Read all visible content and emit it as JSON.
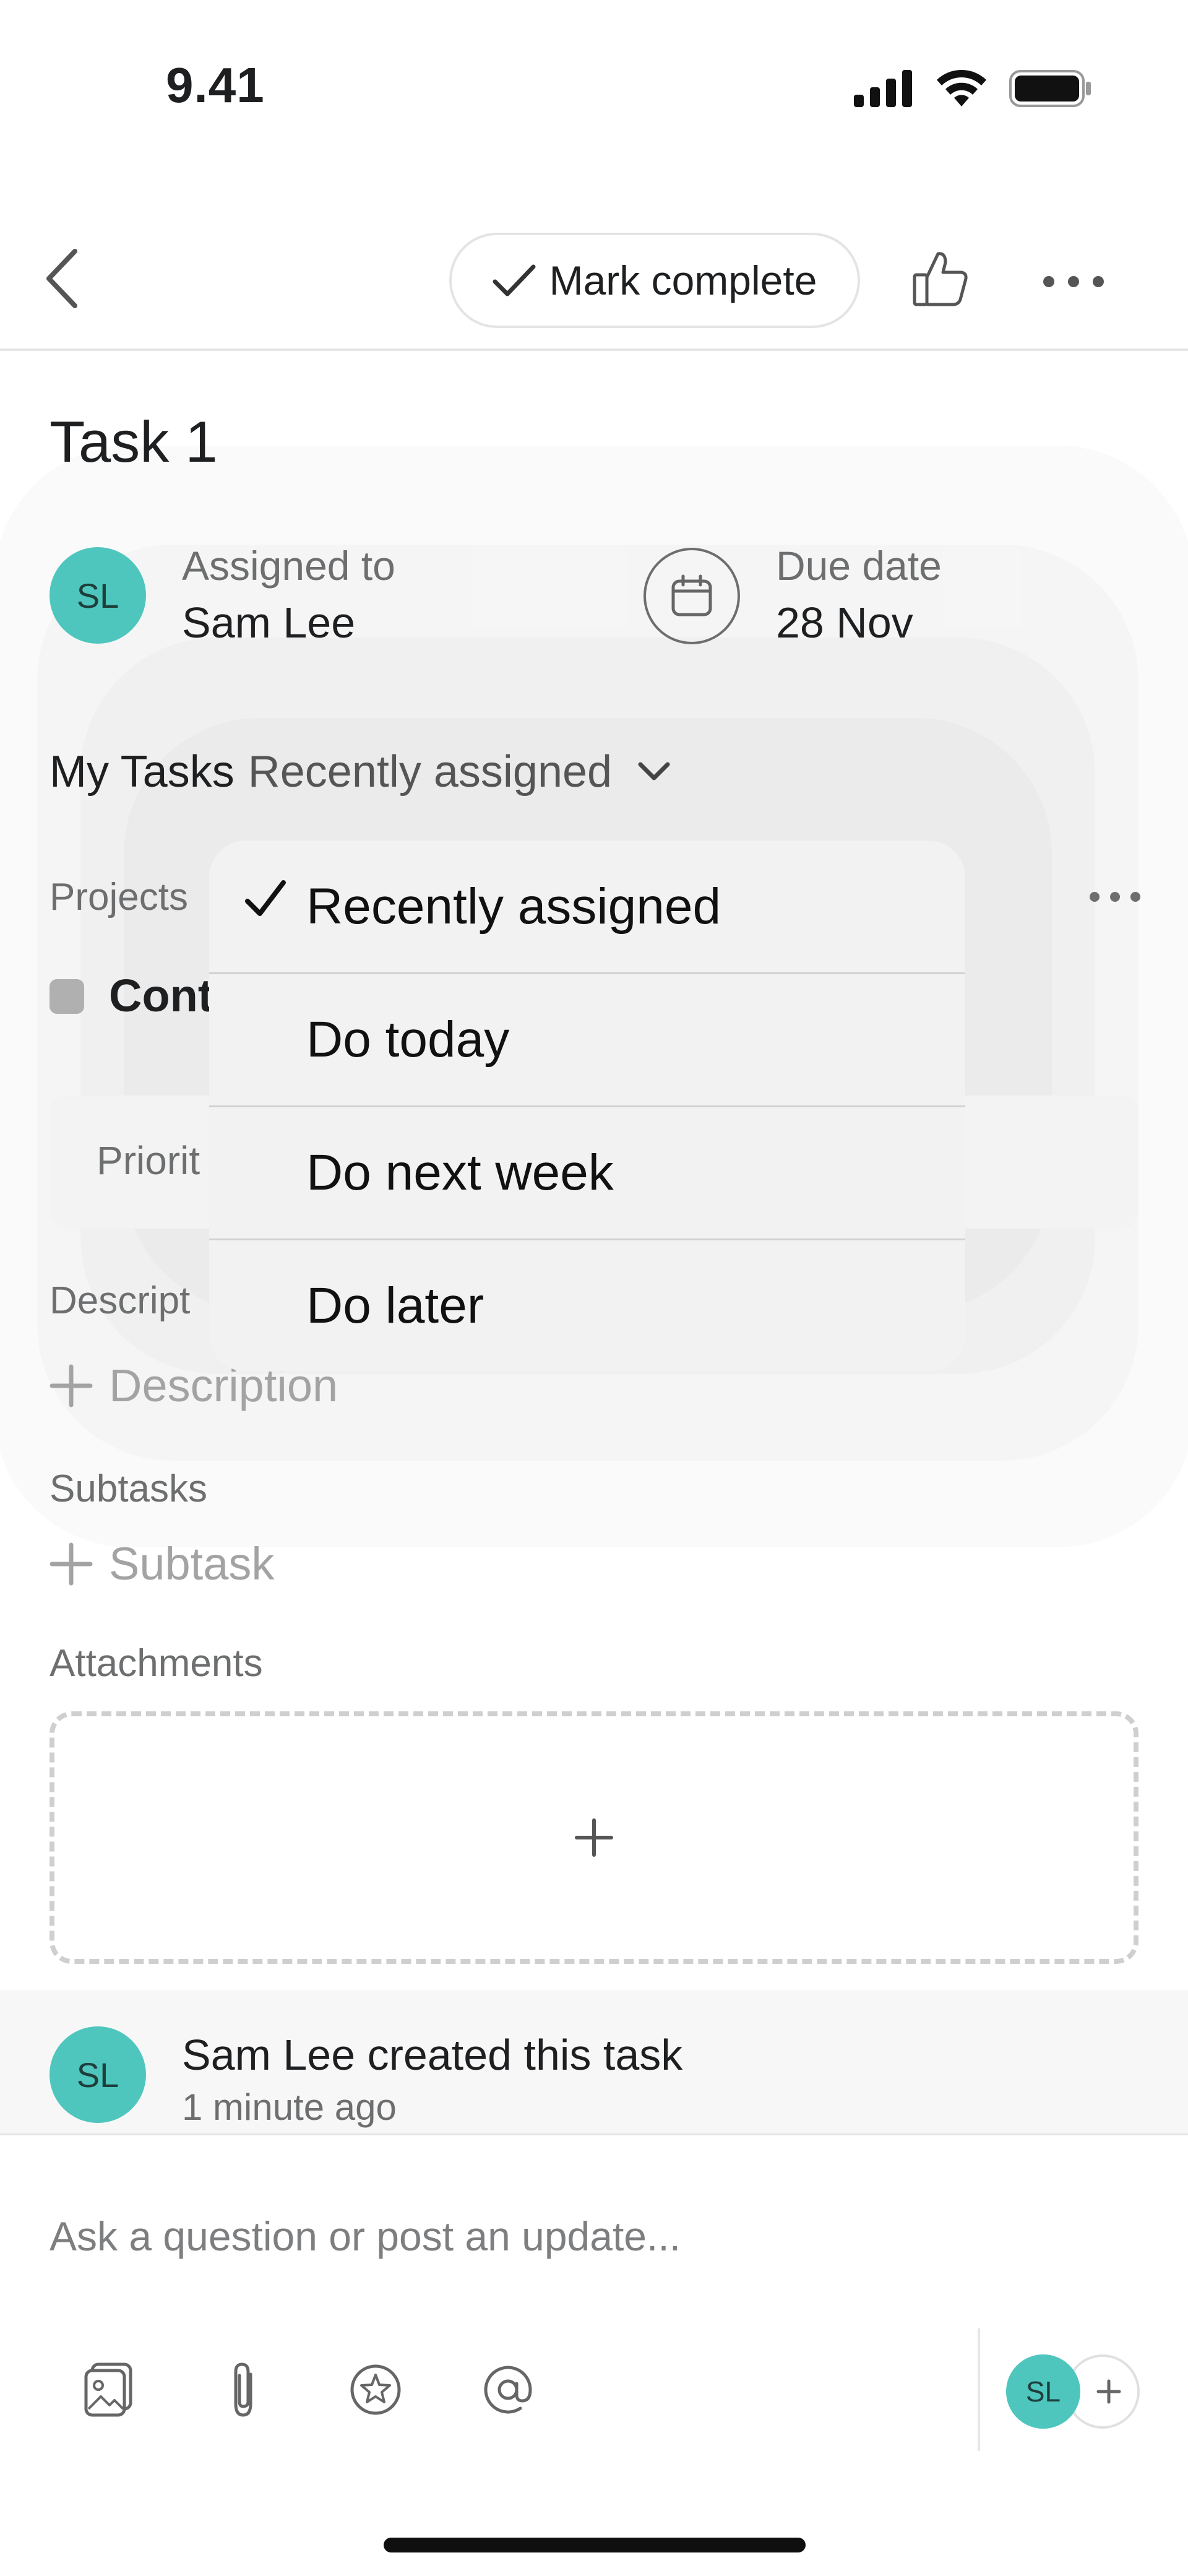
{
  "status_bar": {
    "time": "9.41"
  },
  "nav": {
    "mark_complete_label": "Mark complete"
  },
  "task": {
    "title": "Task 1",
    "assignee": {
      "label": "Assigned to",
      "name": "Sam Lee",
      "initials": "SL"
    },
    "due_date": {
      "label": "Due date",
      "value": "28 Nov"
    },
    "section": {
      "project": "My Tasks",
      "selected": "Recently assigned"
    }
  },
  "sections": {
    "projects_label": "Projects",
    "project_partial": "Cont",
    "priority_partial": "Priorit",
    "description_label_partial": "Descript",
    "description_add": "Description",
    "subtasks_label": "Subtasks",
    "subtask_add": "Subtask",
    "attachments_label": "Attachments"
  },
  "activity": {
    "text": "Sam Lee created this task",
    "time": "1 minute ago",
    "initials": "SL"
  },
  "composer": {
    "placeholder": "Ask a question or post an update...",
    "user_initials": "SL"
  },
  "dropdown": {
    "items": [
      {
        "label": "Recently assigned",
        "selected": true
      },
      {
        "label": "Do today",
        "selected": false
      },
      {
        "label": "Do next week",
        "selected": false
      },
      {
        "label": "Do later",
        "selected": false
      }
    ]
  },
  "colors": {
    "avatar": "#4ec6bd",
    "text": "#1e1f21",
    "muted": "#6d6e6f"
  },
  "icons": [
    "signal-icon",
    "wifi-icon",
    "battery-icon",
    "back-icon",
    "check-icon",
    "thumbs-up-icon",
    "more-icon",
    "calendar-icon",
    "chevron-down-icon",
    "plus-icon",
    "photo-icon",
    "paperclip-icon",
    "star-icon",
    "at-icon"
  ]
}
